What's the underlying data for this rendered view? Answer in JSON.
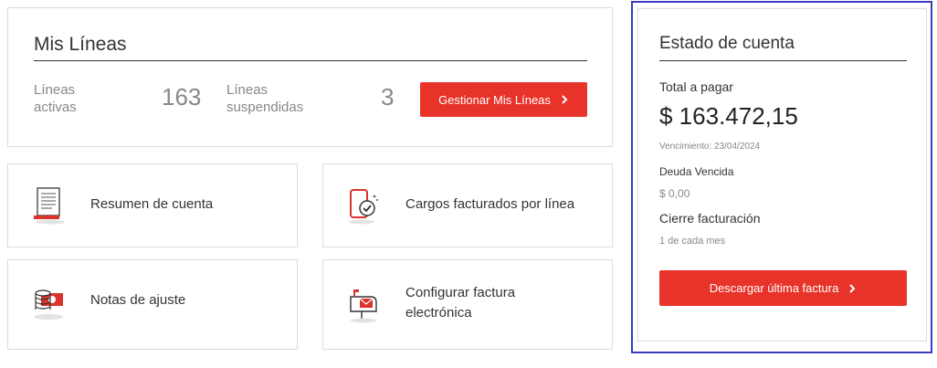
{
  "mis_lineas": {
    "title": "Mis Líneas",
    "activas_label_1": "Líneas",
    "activas_label_2": "activas",
    "activas_count": "163",
    "suspendidas_label_1": "Líneas",
    "suspendidas_label_2": "suspendidas",
    "suspendidas_count": "3",
    "button_label": "Gestionar Mis Líneas"
  },
  "tiles": [
    {
      "label": "Resumen de cuenta",
      "icon": "document-icon"
    },
    {
      "label": "Cargos facturados por línea",
      "icon": "phone-check-icon"
    },
    {
      "label": "Notas de ajuste",
      "icon": "coins-icon"
    },
    {
      "label_line1": "Configurar factura",
      "label_line2": "electrónica",
      "icon": "mailbox-icon"
    }
  ],
  "estado": {
    "title": "Estado de cuenta",
    "total_label": "Total a pagar",
    "total_value": "$ 163.472,15",
    "vencimiento": "Vencimiento: 23/04/2024",
    "deuda_label": "Deuda Vencida",
    "deuda_value": "$ 0,00",
    "cierre_label": "Cierre facturación",
    "cierre_value": "1 de cada mes",
    "button_label": "Descargar última factura"
  },
  "colors": {
    "accent": "#e8332a",
    "highlight_border": "#3b3bbf"
  }
}
